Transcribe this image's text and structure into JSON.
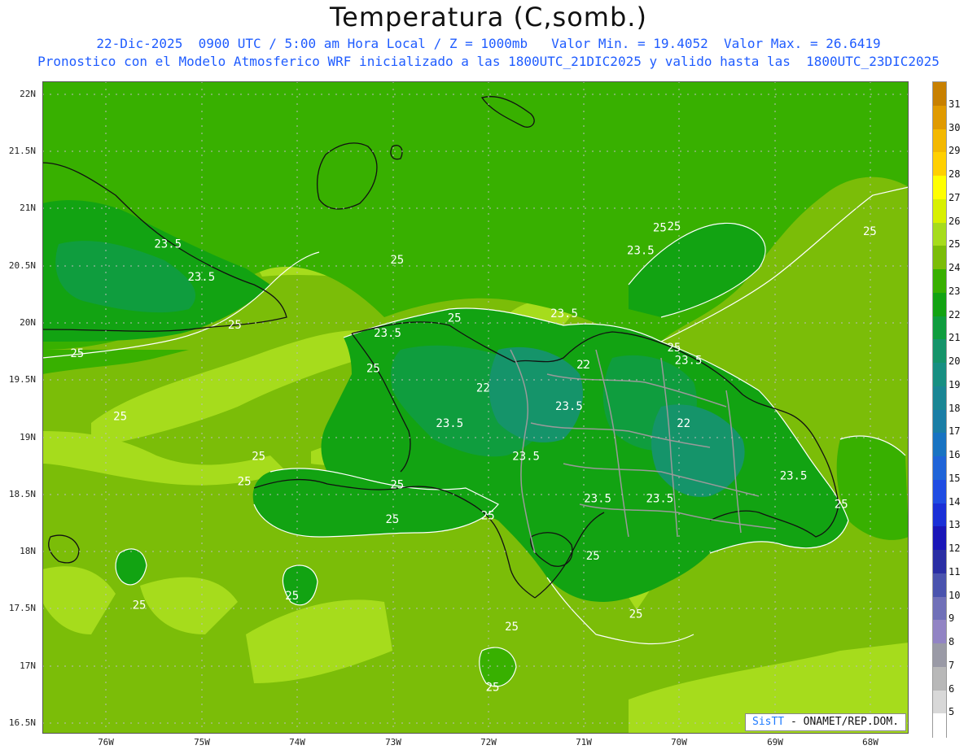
{
  "header": {
    "title": "Temperatura (C,somb.)",
    "subtitle1": "22-Dic-2025  0900 UTC / 5:00 am Hora Local / Z = 1000mb   Valor Min. = 19.4052  Valor Max. = 26.6419",
    "subtitle2": "Pronostico con el Modelo Atmosferico WRF inicializado a las 1800UTC_21DIC2025 y valido hasta las  1800UTC_23DIC2025"
  },
  "map": {
    "lat_labels": [
      "22N",
      "21.5N",
      "21N",
      "20.5N",
      "20N",
      "19.5N",
      "19N",
      "18.5N",
      "18N",
      "17.5N",
      "17N",
      "16.5N"
    ],
    "lon_labels": [
      "76W",
      "75W",
      "74W",
      "73W",
      "72W",
      "71W",
      "70W",
      "69W",
      "68W"
    ],
    "contour_labels": [
      {
        "text": "23.5",
        "lon": -75.35,
        "lat": 20.66
      },
      {
        "text": "23.5",
        "lon": -75.0,
        "lat": 20.37
      },
      {
        "text": "25",
        "lon": -72.95,
        "lat": 20.52
      },
      {
        "text": "25",
        "lon": -74.65,
        "lat": 19.95
      },
      {
        "text": "25",
        "lon": -76.3,
        "lat": 19.7
      },
      {
        "text": "23.5",
        "lon": -73.05,
        "lat": 19.88
      },
      {
        "text": "25",
        "lon": -72.35,
        "lat": 20.01
      },
      {
        "text": "23.5",
        "lon": -71.2,
        "lat": 20.05
      },
      {
        "text": "25",
        "lon": -70.2,
        "lat": 20.8
      },
      {
        "text": "25",
        "lon": -70.05,
        "lat": 20.81
      },
      {
        "text": "25",
        "lon": -68.0,
        "lat": 20.77
      },
      {
        "text": "23.5",
        "lon": -70.4,
        "lat": 20.6
      },
      {
        "text": "25",
        "lon": -73.2,
        "lat": 19.57
      },
      {
        "text": "22",
        "lon": -72.05,
        "lat": 19.4
      },
      {
        "text": "22",
        "lon": -71.0,
        "lat": 19.6
      },
      {
        "text": "23.5",
        "lon": -71.15,
        "lat": 19.24
      },
      {
        "text": "25",
        "lon": -70.05,
        "lat": 19.75
      },
      {
        "text": "23.5",
        "lon": -69.9,
        "lat": 19.64
      },
      {
        "text": "22",
        "lon": -69.95,
        "lat": 19.09
      },
      {
        "text": "23.5",
        "lon": -72.4,
        "lat": 19.09
      },
      {
        "text": "25",
        "lon": -75.85,
        "lat": 19.15
      },
      {
        "text": "23.5",
        "lon": -71.6,
        "lat": 18.8
      },
      {
        "text": "25",
        "lon": -74.4,
        "lat": 18.8
      },
      {
        "text": "25",
        "lon": -74.55,
        "lat": 18.58
      },
      {
        "text": "25",
        "lon": -72.95,
        "lat": 18.55
      },
      {
        "text": "25",
        "lon": -73.0,
        "lat": 18.25
      },
      {
        "text": "25",
        "lon": -72.0,
        "lat": 18.28
      },
      {
        "text": "23.5",
        "lon": -70.85,
        "lat": 18.43
      },
      {
        "text": "23.5",
        "lon": -70.2,
        "lat": 18.43
      },
      {
        "text": "23.5",
        "lon": -68.8,
        "lat": 18.63
      },
      {
        "text": "25",
        "lon": -68.3,
        "lat": 18.38
      },
      {
        "text": "25",
        "lon": -67.35,
        "lat": 18.9
      },
      {
        "text": "25",
        "lon": -70.9,
        "lat": 17.93
      },
      {
        "text": "25",
        "lon": -74.05,
        "lat": 17.58
      },
      {
        "text": "25",
        "lon": -75.65,
        "lat": 17.5
      },
      {
        "text": "25",
        "lon": -71.75,
        "lat": 17.31
      },
      {
        "text": "25",
        "lon": -70.45,
        "lat": 17.42
      },
      {
        "text": "25",
        "lon": -71.95,
        "lat": 16.78
      }
    ]
  },
  "legend": {
    "labels": [
      "31",
      "30",
      "29",
      "28",
      "27",
      "26",
      "25",
      "24",
      "23",
      "22",
      "21",
      "20",
      "19",
      "18",
      "17",
      "16",
      "15",
      "14",
      "13",
      "12",
      "11",
      "10",
      "9",
      "8",
      "7",
      "6",
      "5"
    ],
    "colors": [
      "#c88000",
      "#e09a00",
      "#f3b800",
      "#ffd000",
      "#ffff00",
      "#d8f000",
      "#a6dc1c",
      "#7bbd08",
      "#38b000",
      "#12a312",
      "#0f9d3e",
      "#15946a",
      "#178f82",
      "#1a8694",
      "#1a7ea6",
      "#1873c2",
      "#1f64d8",
      "#1f4ce3",
      "#1a2fd7",
      "#1a16b8",
      "#2a2ea4",
      "#4a53ae",
      "#7070b8",
      "#9284c4",
      "#9a9aa6",
      "#b8b8b8",
      "#d8d8d8",
      "#ffffff"
    ]
  },
  "credit": {
    "brand": "SisTT",
    "text": " - ONAMET/REP.DOM."
  }
}
